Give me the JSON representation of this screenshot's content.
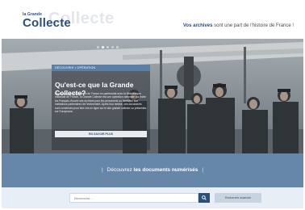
{
  "header": {
    "logo_small": "la Grande",
    "logo_big": "Collecte",
    "tagline_bold": "Vos archives",
    "tagline_rest": " sont une part de l'histoire de France !"
  },
  "hero": {
    "tag": "DÉCOUVRIR L'OPÉRATION",
    "title": "Qu'est-ce que la Grande Collecte?",
    "text": "Organisée par les Archives de France en partenariat avec la Bibliothèque nationale de France, la Grande Collecte est une opération nationale qui invite les Français d'ouvrir ses archives pour les personnels ou familiaux aux institutions partenaires de l'événement. Après leur remise, ces documents sont numérisés pour être mis en ligne sur le site grande collecte ou présentés sur Europeana.",
    "button": "EN SAVOIR PLUS"
  },
  "band": {
    "prefix": "Découvrez ",
    "bold": "les documents numérisés",
    "separator": "|"
  },
  "search": {
    "placeholder": "Recherche...",
    "advanced_label": "Recherche avancée"
  },
  "colors": {
    "brand_blue": "#2c4f7a",
    "band_blue": "#6787a8",
    "tag_blue": "#5c7fa5",
    "search_band": "#e7eef5"
  }
}
